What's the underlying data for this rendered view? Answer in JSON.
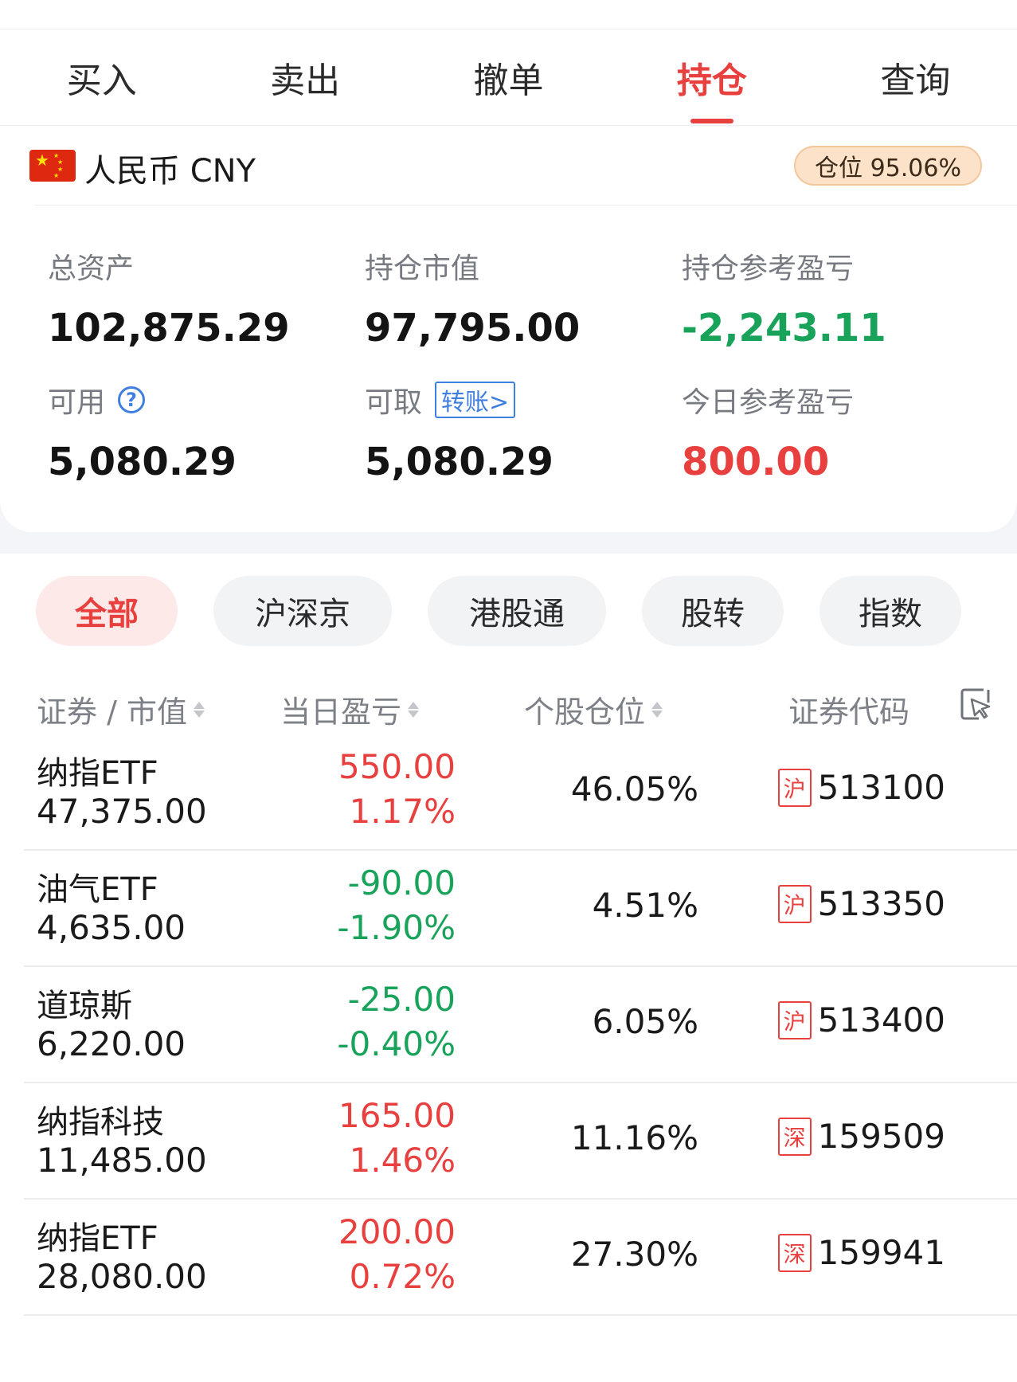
{
  "tabs": [
    {
      "label": "买入",
      "active": false
    },
    {
      "label": "卖出",
      "active": false
    },
    {
      "label": "撤单",
      "active": false
    },
    {
      "label": "持仓",
      "active": true
    },
    {
      "label": "查询",
      "active": false
    }
  ],
  "account": {
    "flag_icon": "cn-flag-icon",
    "currency": "人民币 CNY",
    "position_ratio": "仓位 95.06%"
  },
  "summary": {
    "total_assets": {
      "label": "总资产",
      "value": "102,875.29"
    },
    "market_value": {
      "label": "持仓市值",
      "value": "97,795.00"
    },
    "position_pl": {
      "label": "持仓参考盈亏",
      "value": "-2,243.11"
    },
    "available": {
      "label": "可用",
      "value": "5,080.29",
      "help_icon": "?"
    },
    "withdrawable": {
      "label": "可取",
      "value": "5,080.29",
      "transfer": "转账>"
    },
    "today_pl": {
      "label": "今日参考盈亏",
      "value": "800.00"
    }
  },
  "filters": [
    {
      "label": "全部",
      "active": true
    },
    {
      "label": "沪深京",
      "active": false
    },
    {
      "label": "港股通",
      "active": false
    },
    {
      "label": "股转",
      "active": false
    },
    {
      "label": "指数",
      "active": false
    }
  ],
  "table": {
    "headers": {
      "security": "证券 / 市值",
      "today_pl": "当日盈亏",
      "position": "个股仓位",
      "code": "证券代码"
    },
    "colors": {
      "up": "#e8403f",
      "down": "#19a35a"
    },
    "rows": [
      {
        "name": "纳指ETF",
        "market_value": "47,375.00",
        "pl": "550.00",
        "pl_pct": "1.17%",
        "position": "46.05%",
        "market": "沪",
        "code": "513100",
        "trend": "up"
      },
      {
        "name": "油气ETF",
        "market_value": "4,635.00",
        "pl": "-90.00",
        "pl_pct": "-1.90%",
        "position": "4.51%",
        "market": "沪",
        "code": "513350",
        "trend": "down"
      },
      {
        "name": "道琼斯",
        "market_value": "6,220.00",
        "pl": "-25.00",
        "pl_pct": "-0.40%",
        "position": "6.05%",
        "market": "沪",
        "code": "513400",
        "trend": "down"
      },
      {
        "name": "纳指科技",
        "market_value": "11,485.00",
        "pl": "165.00",
        "pl_pct": "1.46%",
        "position": "11.16%",
        "market": "深",
        "code": "159509",
        "trend": "up"
      },
      {
        "name": "纳指ETF",
        "market_value": "28,080.00",
        "pl": "200.00",
        "pl_pct": "0.72%",
        "position": "27.30%",
        "market": "深",
        "code": "159941",
        "trend": "up"
      }
    ]
  }
}
